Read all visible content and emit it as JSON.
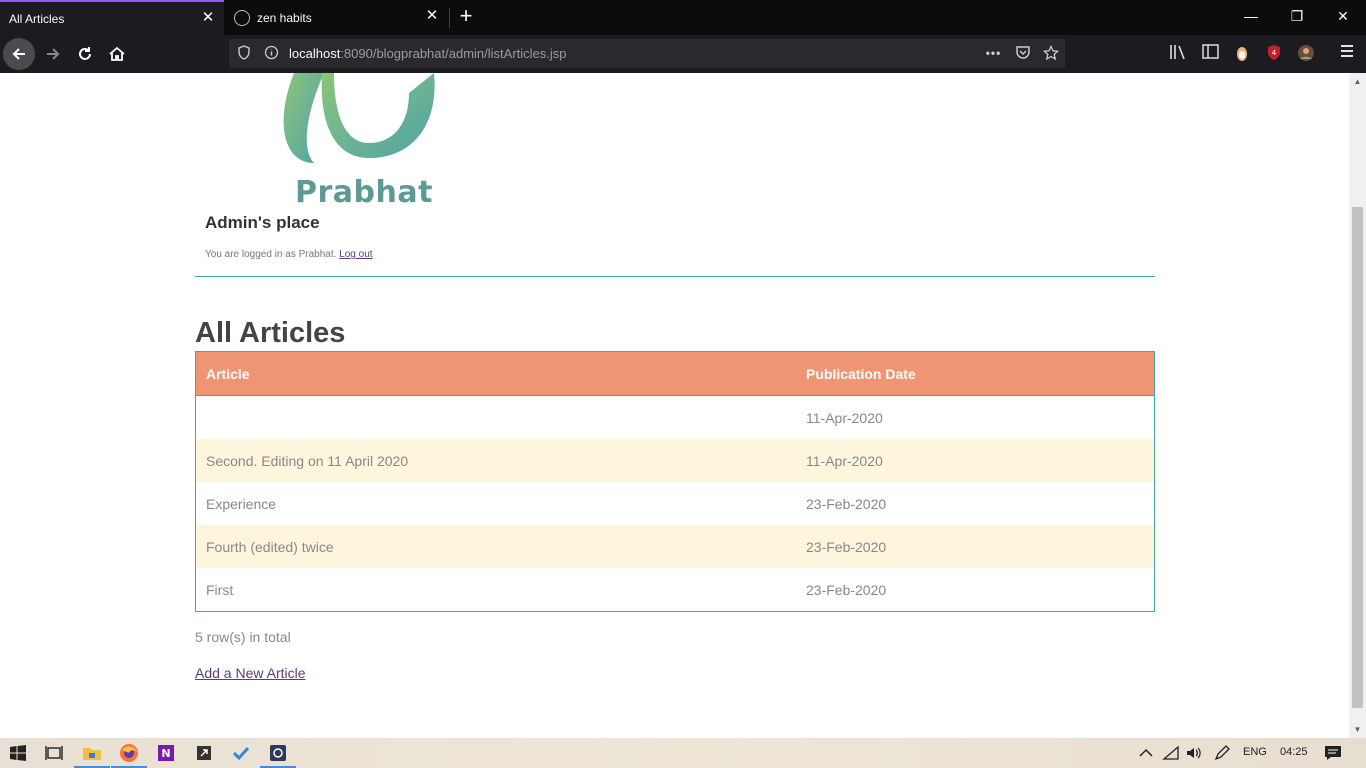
{
  "browser": {
    "tabs": [
      {
        "title": "All Articles",
        "active": true
      },
      {
        "title": "zen habits",
        "active": false
      }
    ],
    "url_host": "localhost",
    "url_path": ":8090/blogprabhat/admin/listArticles.jsp",
    "window_controls": {
      "minimize": "—",
      "restore": "❐",
      "close": "✕"
    }
  },
  "page": {
    "logo_text": "Prabhat",
    "admin_title": "Admin's place",
    "login_prefix": "You are logged in as Prabhat.",
    "logout_label": "Log out",
    "heading": "All Articles",
    "table": {
      "headers": [
        "Article",
        "Publication Date"
      ],
      "rows": [
        {
          "article": "",
          "date": "11-Apr-2020"
        },
        {
          "article": "Second. Editing on 11 April 2020",
          "date": "11-Apr-2020"
        },
        {
          "article": "Experience",
          "date": "23-Feb-2020"
        },
        {
          "article": "Fourth (edited) twice",
          "date": "23-Feb-2020"
        },
        {
          "article": "First",
          "date": "23-Feb-2020"
        }
      ]
    },
    "row_count": "5 row(s) in total",
    "add_link": "Add a New Article"
  },
  "taskbar": {
    "language": "ENG",
    "time": "04:25"
  },
  "colors": {
    "header_bg": "#f09574",
    "table_border": "#47a4a4",
    "alt_row": "#fef6dc",
    "link": "#5b3b7a"
  }
}
